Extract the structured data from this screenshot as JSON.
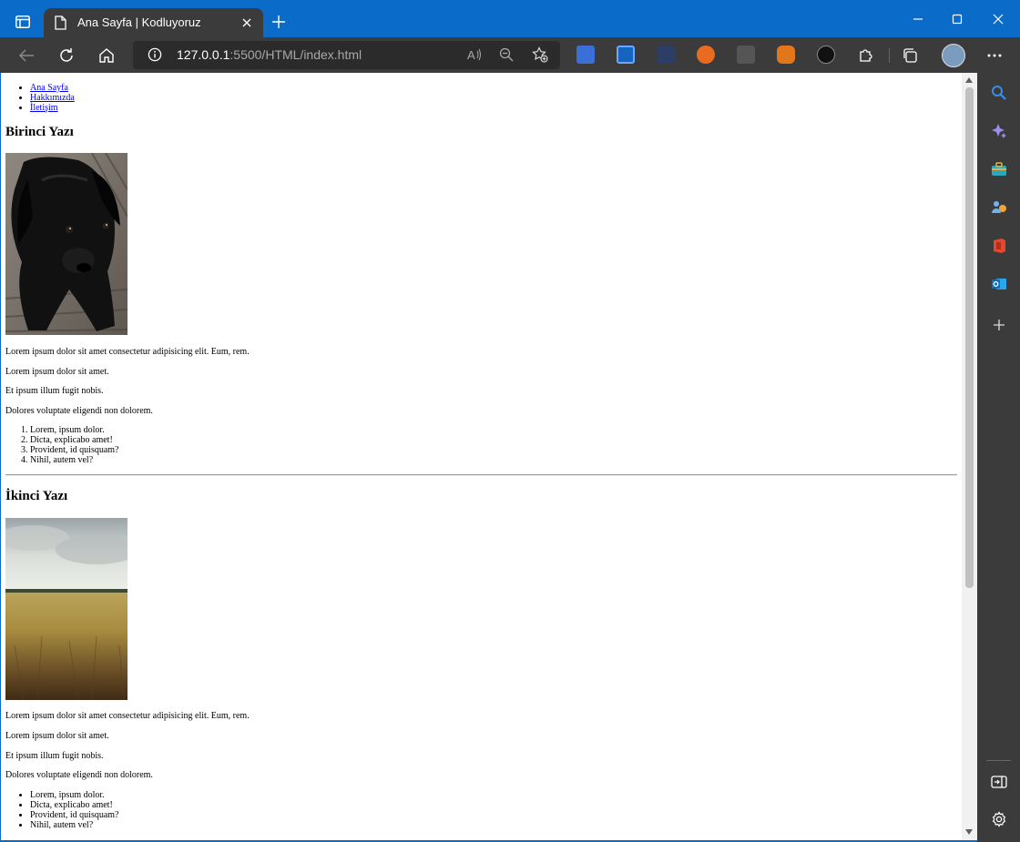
{
  "browser": {
    "tab_title": "Ana Sayfa | Kodluyoruz",
    "url_host": "127.0.0.1",
    "url_rest": ":5500/HTML/index.html"
  },
  "page": {
    "nav": [
      "Ana Sayfa",
      "Hakkımızda",
      "İletişim"
    ],
    "articles": [
      {
        "title": "Birinci Yazı",
        "image": "black-puppy-photo",
        "paragraphs": [
          "Lorem ipsum dolor sit amet consectetur adipisicing elit. Eum, rem.",
          "Lorem ipsum dolor sit amet.",
          "Et ipsum illum fugit nobis.",
          "Dolores voluptate eligendi non dolorem."
        ],
        "list_type": "ordered",
        "list": [
          "Lorem, ipsum dolor.",
          "Dicta, explicabo amet!",
          "Provident, id quisquam?",
          "Nihil, autem vel?"
        ]
      },
      {
        "title": "İkinci Yazı",
        "image": "wheat-field-photo",
        "paragraphs": [
          "Lorem ipsum dolor sit amet consectetur adipisicing elit. Eum, rem.",
          "Lorem ipsum dolor sit amet.",
          "Et ipsum illum fugit nobis.",
          "Dolores voluptate eligendi non dolorem."
        ],
        "list_type": "unordered",
        "list": [
          "Lorem, ipsum dolor.",
          "Dicta, explicabo amet!",
          "Provident, id quisquam?",
          "Nihil, autem vel?"
        ]
      }
    ]
  },
  "colors": {
    "titlebar": "#0a6bc9",
    "chrome": "#3b3b3b",
    "link": "#0000ee"
  }
}
